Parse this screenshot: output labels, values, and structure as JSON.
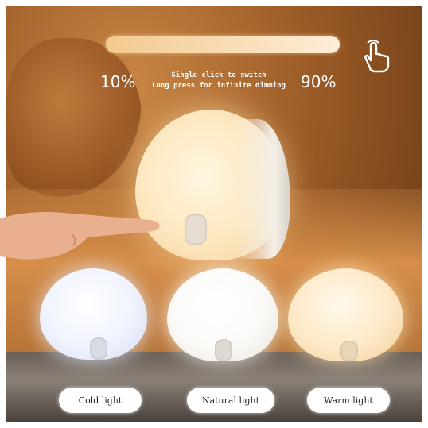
{
  "slider": {
    "min_label": "10%",
    "max_label": "90%",
    "instruction_line1": "Single click to switch",
    "instruction_line2": "Long press for infinite dimming"
  },
  "icons": {
    "touch": "hand-tap-icon"
  },
  "modes": [
    {
      "label": "Cold light",
      "color": "#eef2ff"
    },
    {
      "label": "Natural light",
      "color": "#faf9f5"
    },
    {
      "label": "Warm light",
      "color": "#fce4bd"
    }
  ]
}
